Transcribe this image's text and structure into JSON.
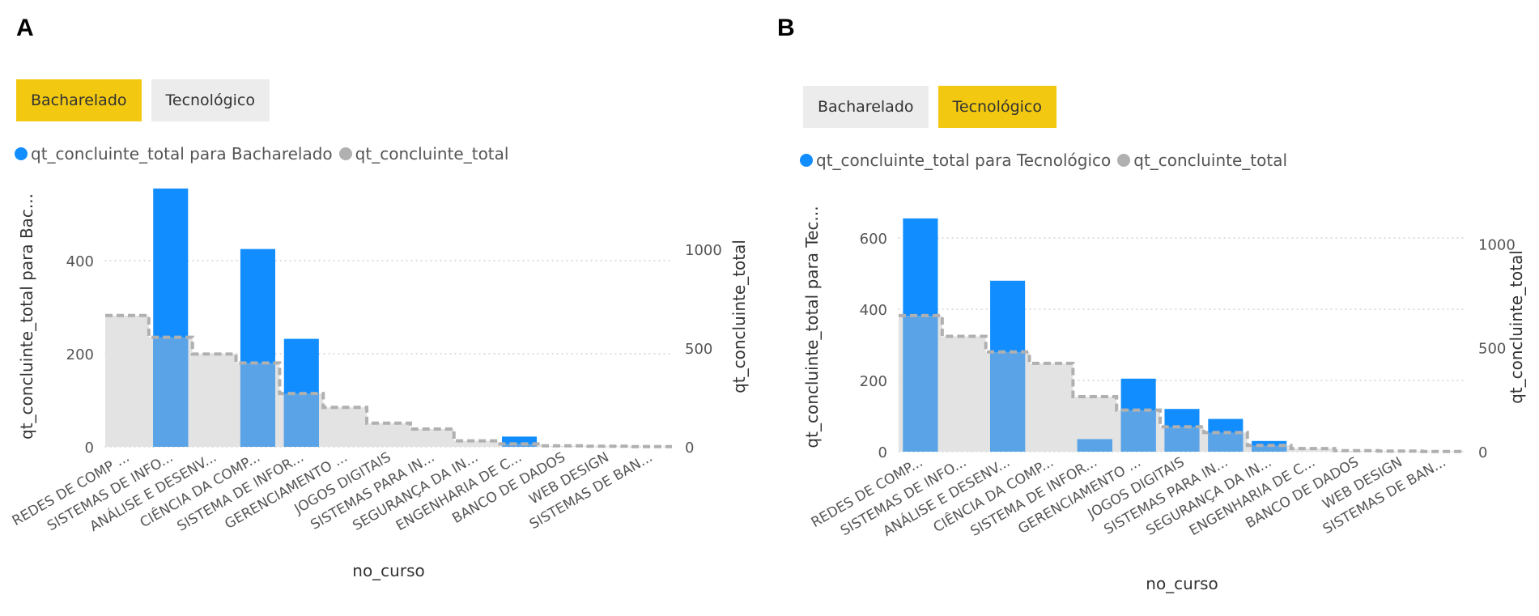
{
  "colors": {
    "highlight": "#118dff",
    "overlap": "#5aa3e6",
    "total_fill": "#e3e3e3",
    "total_line": "#b0b0b0",
    "active_slicer": "#f2c811",
    "inactive_slicer": "#ececec",
    "legend_total_dot": "#b0b0b0"
  },
  "panels": [
    {
      "letter": "A",
      "slicer": [
        "Bacharelado",
        "Tecnológico"
      ],
      "active_slicer": 0,
      "legend": [
        {
          "label": "qt_concluinte_total para Bacharelado"
        },
        {
          "label": "qt_concluinte_total"
        }
      ]
    },
    {
      "letter": "B",
      "slicer": [
        "Bacharelado",
        "Tecnológico"
      ],
      "active_slicer": 1,
      "legend": [
        {
          "label": "qt_concluinte_total para Tecnológico"
        },
        {
          "label": "qt_concluinte_total"
        }
      ]
    }
  ],
  "chart_data": [
    {
      "type": "bar",
      "categories": [
        "REDES DE COMP ...",
        "SISTEMAS DE INFO...",
        "ANÁLISE E DESENV...",
        "CIÊNCIA DA COMP...",
        "SISTEMA DE INFOR...",
        "GERENCIAMENTO ...",
        "JOGOS DIGITAIS",
        "SISTEMAS PARA IN...",
        "SEGURANÇA DA IN...",
        "ENGENHARIA DE C...",
        "BANCO DE DADOS",
        "WEB DESIGN",
        "SISTEMAS DE BAN..."
      ],
      "xlabel": "no_curso",
      "ylabel": "qt_concluinte_total para Bac...",
      "y2label": "qt_concluinte_total",
      "ylim": [
        0,
        560
      ],
      "y2lim": [
        0,
        1320
      ],
      "yticks": [
        0,
        200,
        400
      ],
      "y2ticks": [
        0,
        500,
        1000
      ],
      "grid": true,
      "series": [
        {
          "name": "qt_concluinte_total para Bacharelado",
          "axis": "left",
          "values": [
            0,
            555,
            0,
            425,
            232,
            0,
            0,
            0,
            0,
            22,
            0,
            0,
            0
          ]
        },
        {
          "name": "qt_concluinte_total",
          "axis": "right",
          "values": [
            665,
            555,
            470,
            425,
            270,
            200,
            120,
            90,
            30,
            15,
            5,
            3,
            1
          ]
        }
      ]
    },
    {
      "type": "bar",
      "categories": [
        "REDES DE COMP...",
        "SISTEMAS DE INFO...",
        "ANÁLISE E DESENV...",
        "CIÊNCIA DA COMP...",
        "SISTEMA DE INFOR...",
        "GERENCIAMENTO ...",
        "JOGOS DIGITAIS",
        "SISTEMAS PARA IN...",
        "SEGURANÇA DA IN...",
        "ENGENHARIA DE C...",
        "BANCO DE DADOS",
        "WEB DESIGN",
        "SISTEMAS DE BAN..."
      ],
      "xlabel": "no_curso",
      "ylabel": "qt_concluinte_total para Tec...",
      "y2label": "qt_concluinte_total",
      "ylim": [
        0,
        700
      ],
      "y2lim": [
        0,
        1200
      ],
      "yticks": [
        0,
        200,
        400,
        600
      ],
      "y2ticks": [
        0,
        500,
        1000
      ],
      "grid": true,
      "series": [
        {
          "name": "qt_concluinte_total para Tecnológico",
          "axis": "left",
          "values": [
            655,
            0,
            480,
            0,
            35,
            205,
            120,
            92,
            30,
            0,
            0,
            0,
            0
          ]
        },
        {
          "name": "qt_concluinte_total",
          "axis": "right",
          "values": [
            655,
            555,
            480,
            425,
            265,
            200,
            120,
            92,
            30,
            15,
            5,
            3,
            1
          ]
        }
      ]
    }
  ]
}
